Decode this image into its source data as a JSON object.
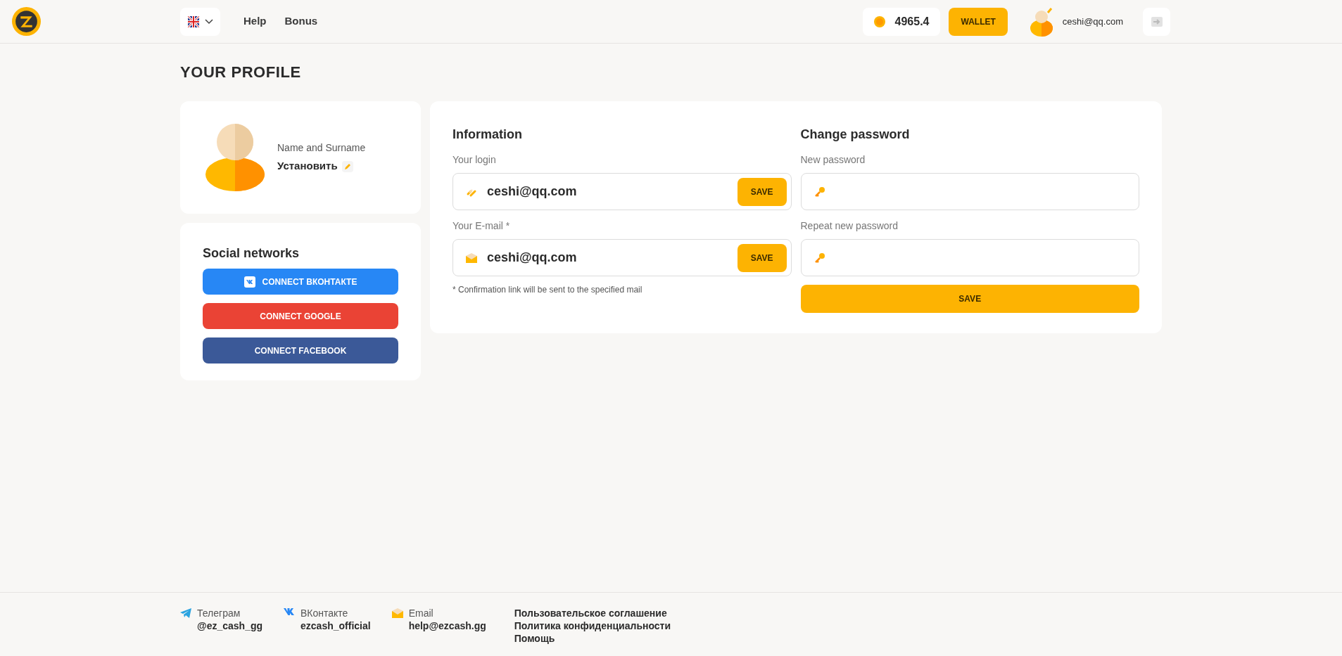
{
  "header": {
    "nav": [
      "Help",
      "Bonus"
    ],
    "balance": "4965.4",
    "wallet_button": "WALLET",
    "user_email": "ceshi@qq.com"
  },
  "page_title": "YOUR PROFILE",
  "profile": {
    "name_label": "Name and Surname",
    "name_value": "Установить"
  },
  "social": {
    "title": "Social networks",
    "buttons": [
      {
        "kind": "vk",
        "label": "CONNECT ВКОНТАКТЕ",
        "color": "#2787f5"
      },
      {
        "kind": "google",
        "label": "CONNECT GOOGLE",
        "color": "#ea4335"
      },
      {
        "kind": "facebook",
        "label": "CONNECT FACEBOOK",
        "color": "#3b5998"
      }
    ]
  },
  "information": {
    "title": "Information",
    "fields": [
      {
        "kind": "login",
        "label": "Your login",
        "value": "ceshi@qq.com",
        "button": "SAVE"
      },
      {
        "kind": "email",
        "label": "Your E-mail *",
        "value": "ceshi@qq.com",
        "button": "SAVE"
      }
    ],
    "note": "* Confirmation link will be sent to the specified mail"
  },
  "password": {
    "title": "Change password",
    "fields": [
      {
        "label": "New password"
      },
      {
        "label": "Repeat new password"
      }
    ],
    "button": "SAVE"
  },
  "footer": {
    "contacts": [
      {
        "kind": "telegram",
        "label": "Телеграм",
        "value": "@ez_cash_gg"
      },
      {
        "kind": "vk",
        "label": "ВКонтакте",
        "value": "ezcash_official"
      },
      {
        "kind": "email",
        "label": "Email",
        "value": "help@ezcash.gg"
      }
    ],
    "links": [
      "Пользовательское соглашение",
      "Политика конфиденциальности",
      "Помощь"
    ]
  }
}
